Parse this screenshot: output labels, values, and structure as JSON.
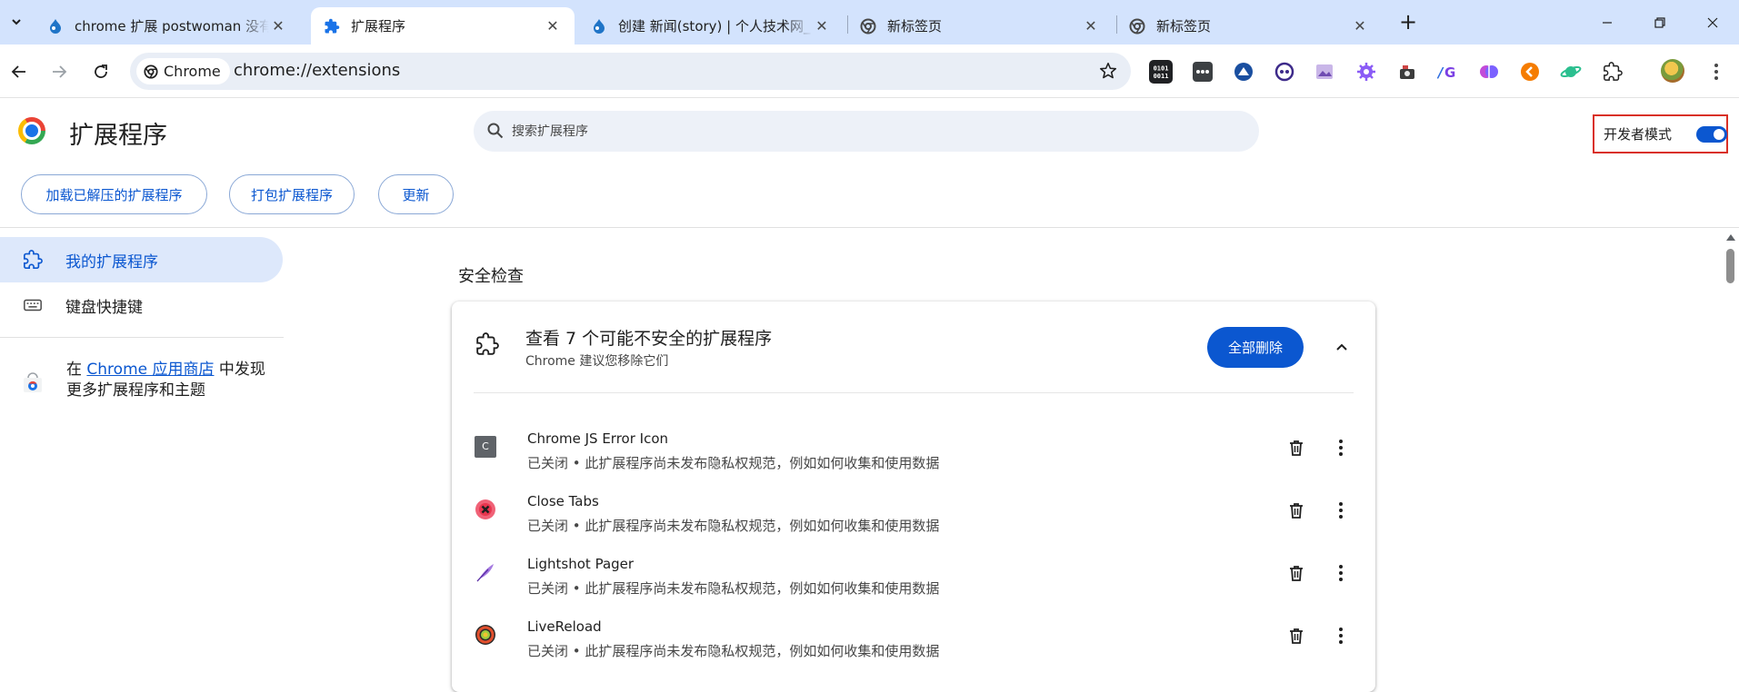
{
  "browser": {
    "tabs": [
      {
        "title": "chrome 扩展 postwoman 没有"
      },
      {
        "title": "扩展程序"
      },
      {
        "title": "创建 新闻(story) | 个人技术网_"
      },
      {
        "title": "新标签页"
      },
      {
        "title": "新标签页"
      }
    ],
    "close_glyph": "✕",
    "new_tab_glyph": "+"
  },
  "toolbar": {
    "site_chip": "Chrome",
    "url": "chrome://extensions"
  },
  "extensions_page": {
    "title": "扩展程序",
    "search_placeholder": "搜索扩展程序",
    "developer_mode_label": "开发者模式",
    "developer_mode_on": true,
    "buttons": {
      "load_unpacked": "加载已解压的扩展程序",
      "pack": "打包扩展程序",
      "update": "更新"
    }
  },
  "sidebar": {
    "items": [
      {
        "label": "我的扩展程序"
      },
      {
        "label": "键盘快捷键"
      }
    ],
    "store_prefix": "在 ",
    "store_link": "Chrome 应用商店",
    "store_suffix": " 中发现更多扩展程序和主题"
  },
  "safety_check": {
    "section_title": "安全检查",
    "card_title": "查看 7 个可能不安全的扩展程序",
    "card_subtitle": "Chrome 建议您移除它们",
    "remove_all_label": "全部删除",
    "extensions": [
      {
        "name": "Chrome JS Error Icon",
        "status": "已关闭 • 此扩展程序尚未发布隐私权规范，例如如何收集和使用数据",
        "icon": "c-letter-icon"
      },
      {
        "name": "Close Tabs",
        "status": "已关闭 • 此扩展程序尚未发布隐私权规范，例如如何收集和使用数据",
        "icon": "red-x-icon"
      },
      {
        "name": "Lightshot Pager",
        "status": "已关闭 • 此扩展程序尚未发布隐私权规范，例如如何收集和使用数据",
        "icon": "feather-icon"
      },
      {
        "name": "LiveReload",
        "status": "已关闭 • 此扩展程序尚未发布隐私权规范，例如如何收集和使用数据",
        "icon": "livereload-icon"
      }
    ],
    "c_letter": "C"
  },
  "colors": {
    "accent": "#0b57d0",
    "tabstrip": "#d3e3fd",
    "highlight_border": "#d93025"
  }
}
